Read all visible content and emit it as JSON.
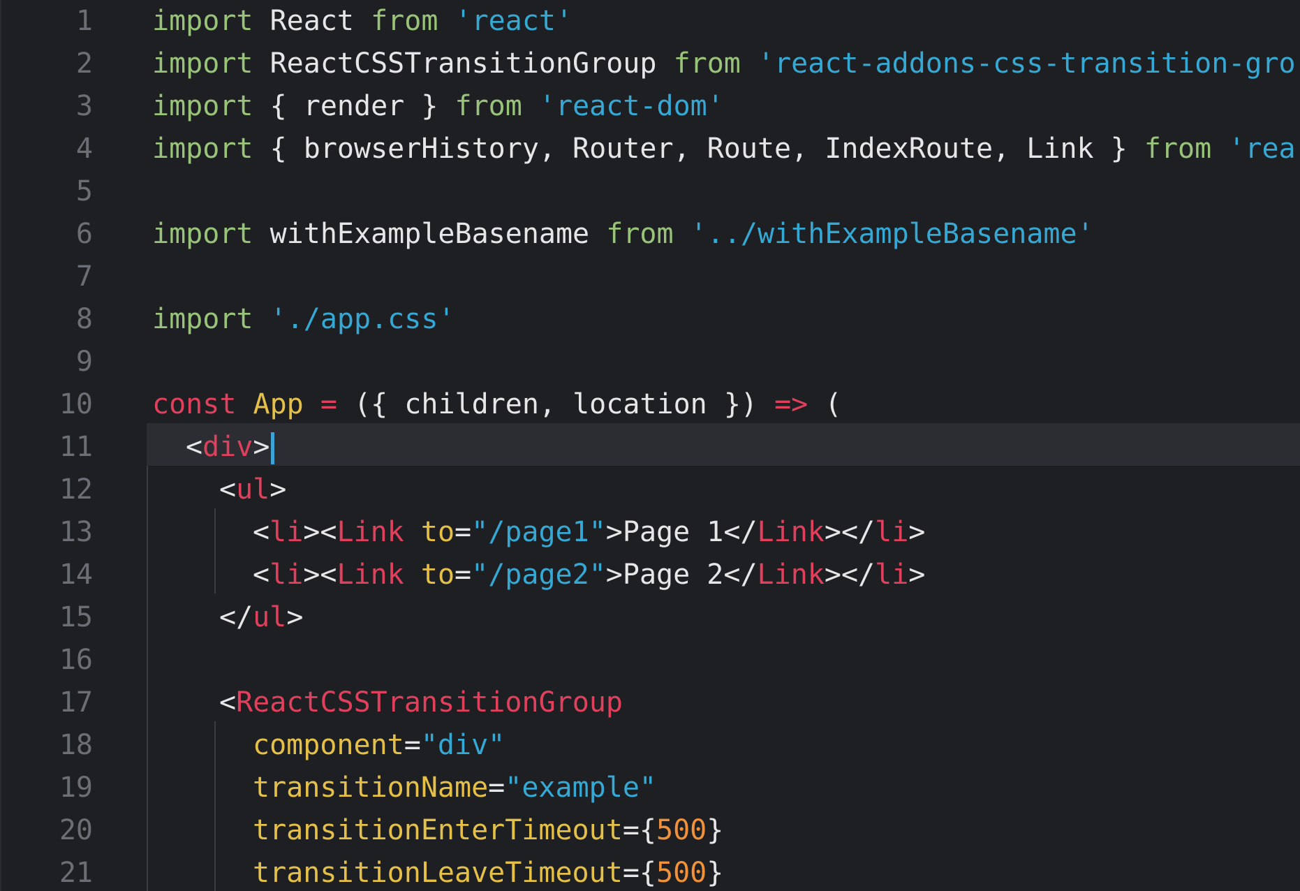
{
  "editor": {
    "cursor_line": 11,
    "lines": [
      {
        "n": "1",
        "indent": 0,
        "tokens": [
          [
            "kw",
            "import"
          ],
          [
            "ident",
            " React "
          ],
          [
            "kw",
            "from"
          ],
          [
            "ident",
            " "
          ],
          [
            "str",
            "'react'"
          ]
        ]
      },
      {
        "n": "2",
        "indent": 0,
        "tokens": [
          [
            "kw",
            "import"
          ],
          [
            "ident",
            " ReactCSSTransitionGroup "
          ],
          [
            "kw",
            "from"
          ],
          [
            "ident",
            " "
          ],
          [
            "str",
            "'react-addons-css-transition-gro"
          ]
        ]
      },
      {
        "n": "3",
        "indent": 0,
        "tokens": [
          [
            "kw",
            "import"
          ],
          [
            "ident",
            " { render } "
          ],
          [
            "kw",
            "from"
          ],
          [
            "ident",
            " "
          ],
          [
            "str",
            "'react-dom'"
          ]
        ]
      },
      {
        "n": "4",
        "indent": 0,
        "tokens": [
          [
            "kw",
            "import"
          ],
          [
            "ident",
            " { browserHistory, Router, Route, IndexRoute, Link } "
          ],
          [
            "kw",
            "from"
          ],
          [
            "ident",
            " "
          ],
          [
            "str",
            "'rea"
          ]
        ]
      },
      {
        "n": "5",
        "indent": 0,
        "tokens": []
      },
      {
        "n": "6",
        "indent": 0,
        "tokens": [
          [
            "kw",
            "import"
          ],
          [
            "ident",
            " withExampleBasename "
          ],
          [
            "kw",
            "from"
          ],
          [
            "ident",
            " "
          ],
          [
            "str",
            "'../withExampleBasename'"
          ]
        ]
      },
      {
        "n": "7",
        "indent": 0,
        "tokens": []
      },
      {
        "n": "8",
        "indent": 0,
        "tokens": [
          [
            "kw",
            "import"
          ],
          [
            "ident",
            " "
          ],
          [
            "str",
            "'./app.css'"
          ]
        ]
      },
      {
        "n": "9",
        "indent": 0,
        "tokens": []
      },
      {
        "n": "10",
        "indent": 0,
        "tokens": [
          [
            "const",
            "const"
          ],
          [
            "ident",
            " "
          ],
          [
            "cls",
            "App"
          ],
          [
            "ident",
            " "
          ],
          [
            "const",
            "="
          ],
          [
            "ident",
            " ({ children, location }) "
          ],
          [
            "const",
            "=>"
          ],
          [
            "ident",
            " ("
          ]
        ]
      },
      {
        "n": "11",
        "indent": 1,
        "tokens": [
          [
            "punct",
            "<"
          ],
          [
            "const",
            "div"
          ],
          [
            "punct",
            ">"
          ]
        ]
      },
      {
        "n": "12",
        "indent": 2,
        "tokens": [
          [
            "punct",
            "<"
          ],
          [
            "const",
            "ul"
          ],
          [
            "punct",
            ">"
          ]
        ]
      },
      {
        "n": "13",
        "indent": 3,
        "tokens": [
          [
            "punct",
            "<"
          ],
          [
            "const",
            "li"
          ],
          [
            "punct",
            "><"
          ],
          [
            "const",
            "Link"
          ],
          [
            "ident",
            " "
          ],
          [
            "cls",
            "to"
          ],
          [
            "punct",
            "="
          ],
          [
            "str",
            "\"/page1\""
          ],
          [
            "punct",
            ">Page 1</"
          ],
          [
            "const",
            "Link"
          ],
          [
            "punct",
            "></"
          ],
          [
            "const",
            "li"
          ],
          [
            "punct",
            ">"
          ]
        ]
      },
      {
        "n": "14",
        "indent": 3,
        "tokens": [
          [
            "punct",
            "<"
          ],
          [
            "const",
            "li"
          ],
          [
            "punct",
            "><"
          ],
          [
            "const",
            "Link"
          ],
          [
            "ident",
            " "
          ],
          [
            "cls",
            "to"
          ],
          [
            "punct",
            "="
          ],
          [
            "str",
            "\"/page2\""
          ],
          [
            "punct",
            ">Page 2</"
          ],
          [
            "const",
            "Link"
          ],
          [
            "punct",
            "></"
          ],
          [
            "const",
            "li"
          ],
          [
            "punct",
            ">"
          ]
        ]
      },
      {
        "n": "15",
        "indent": 2,
        "tokens": [
          [
            "punct",
            "</"
          ],
          [
            "const",
            "ul"
          ],
          [
            "punct",
            ">"
          ]
        ]
      },
      {
        "n": "16",
        "indent": 0,
        "tokens": []
      },
      {
        "n": "17",
        "indent": 2,
        "tokens": [
          [
            "punct",
            "<"
          ],
          [
            "const",
            "ReactCSSTransitionGroup"
          ]
        ]
      },
      {
        "n": "18",
        "indent": 3,
        "tokens": [
          [
            "cls",
            "component"
          ],
          [
            "punct",
            "="
          ],
          [
            "str",
            "\"div\""
          ]
        ]
      },
      {
        "n": "19",
        "indent": 3,
        "tokens": [
          [
            "cls",
            "transitionName"
          ],
          [
            "punct",
            "="
          ],
          [
            "str",
            "\"example\""
          ]
        ]
      },
      {
        "n": "20",
        "indent": 3,
        "tokens": [
          [
            "cls",
            "transitionEnterTimeout"
          ],
          [
            "punct",
            "={"
          ],
          [
            "num",
            "500"
          ],
          [
            "punct",
            "}"
          ]
        ]
      },
      {
        "n": "21",
        "indent": 3,
        "tokens": [
          [
            "cls",
            "transitionLeaveTimeout"
          ],
          [
            "punct",
            "={"
          ],
          [
            "num",
            "500"
          ],
          [
            "punct",
            "}"
          ]
        ]
      }
    ]
  }
}
